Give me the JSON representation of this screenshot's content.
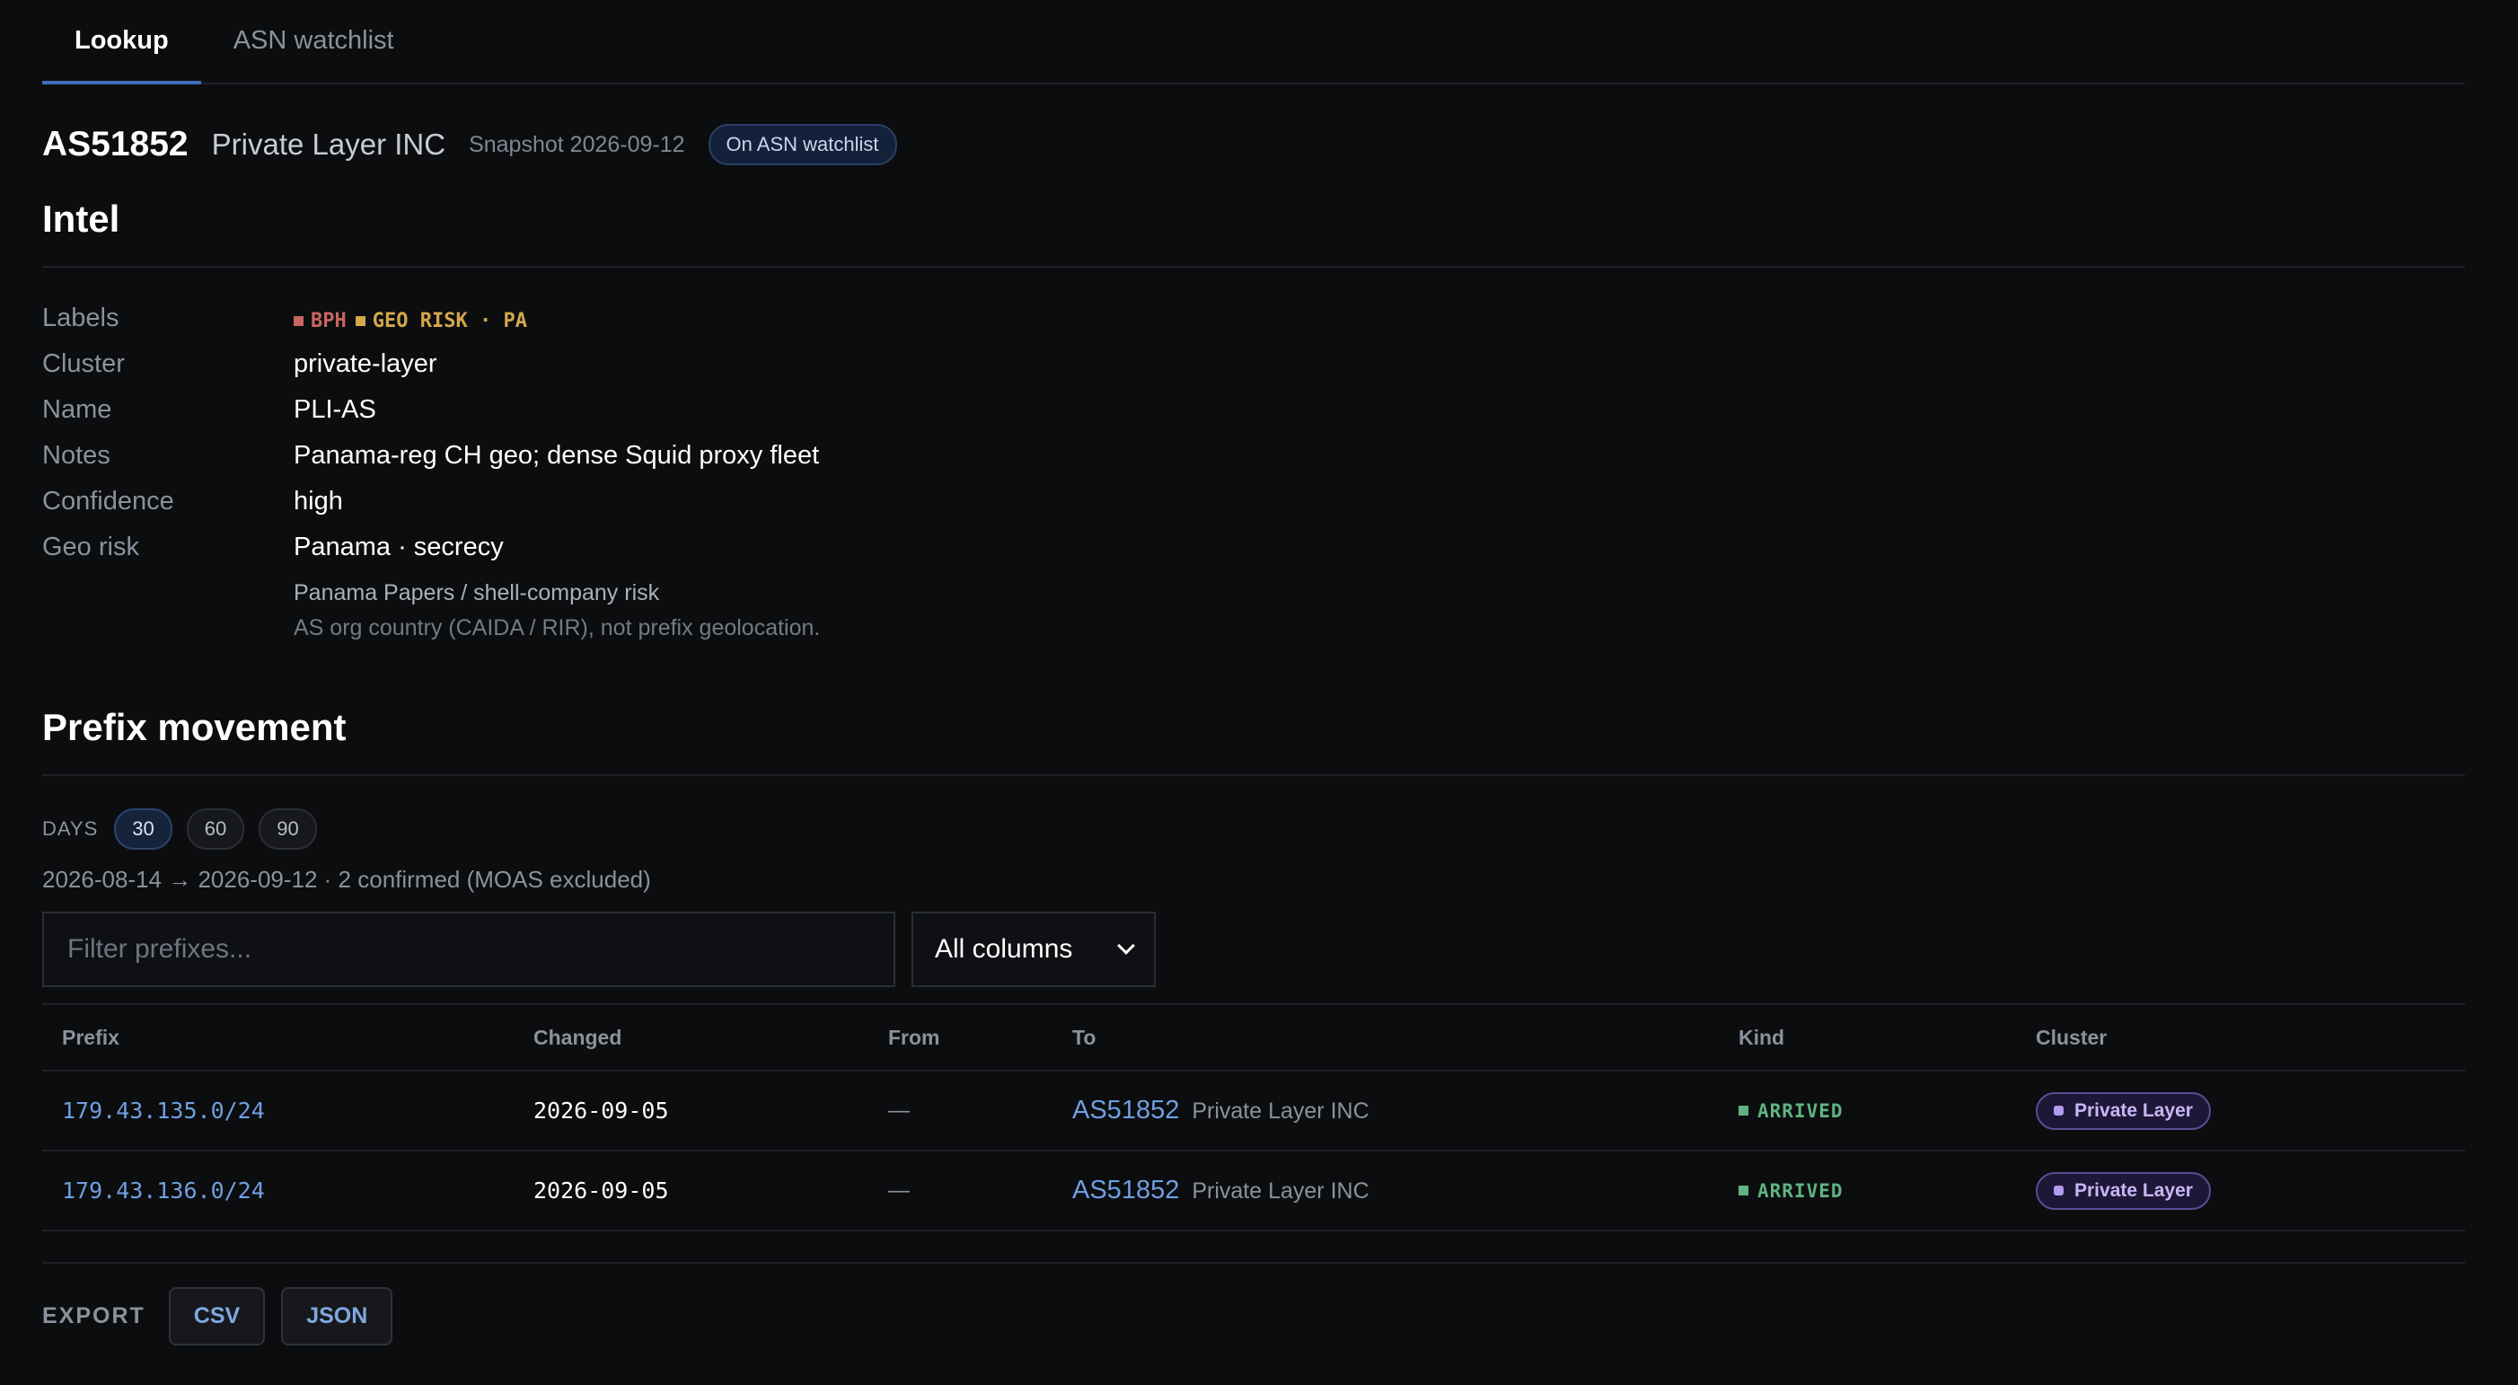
{
  "tabs": [
    {
      "label": "Lookup",
      "active": true
    },
    {
      "label": "ASN watchlist",
      "active": false
    }
  ],
  "header": {
    "asn": "AS51852",
    "org": "Private Layer INC",
    "snapshot": "Snapshot 2026-09-12",
    "watch_badge": "On ASN watchlist"
  },
  "intel": {
    "title": "Intel",
    "labels_key": "Labels",
    "labels": [
      {
        "text": "BPH",
        "color": "#c8665f"
      },
      {
        "text": "GEO RISK · PA",
        "color": "#d3a84b"
      }
    ],
    "rows": [
      {
        "key": "Cluster",
        "value": "private-layer"
      },
      {
        "key": "Name",
        "value": "PLI-AS"
      },
      {
        "key": "Notes",
        "value": "Panama-reg CH geo; dense Squid proxy fleet"
      },
      {
        "key": "Confidence",
        "value": "high"
      },
      {
        "key": "Geo risk",
        "value": "Panama · secrecy"
      }
    ],
    "geo_sub1": "Panama Papers / shell-company risk",
    "geo_sub2": "AS org country (CAIDA / RIR), not prefix geolocation."
  },
  "prefix": {
    "title": "Prefix movement",
    "days_label": "DAYS",
    "days": [
      {
        "label": "30",
        "active": true
      },
      {
        "label": "60",
        "active": false
      },
      {
        "label": "90",
        "active": false
      }
    ],
    "range": "2026-08-14 → 2026-09-12 · 2 confirmed (MOAS excluded)",
    "filter_placeholder": "Filter prefixes...",
    "filter_value": "",
    "column_select": "All columns",
    "columns": [
      "Prefix",
      "Changed",
      "From",
      "To",
      "Kind",
      "Cluster"
    ],
    "rows": [
      {
        "prefix": "179.43.135.0/24",
        "changed": "2026-09-05",
        "from": "—",
        "to_asn": "AS51852",
        "to_org": "Private Layer INC",
        "kind": "ARRIVED",
        "cluster": "Private Layer"
      },
      {
        "prefix": "179.43.136.0/24",
        "changed": "2026-09-05",
        "from": "—",
        "to_asn": "AS51852",
        "to_org": "Private Layer INC",
        "kind": "ARRIVED",
        "cluster": "Private Layer"
      }
    ]
  },
  "export": {
    "label": "EXPORT",
    "csv": "CSV",
    "json": "JSON"
  },
  "colors": {
    "accent": "#3f6fb8",
    "link": "#6f9fe0",
    "arrived": "#5fb383",
    "cluster": "#b39bf0"
  }
}
